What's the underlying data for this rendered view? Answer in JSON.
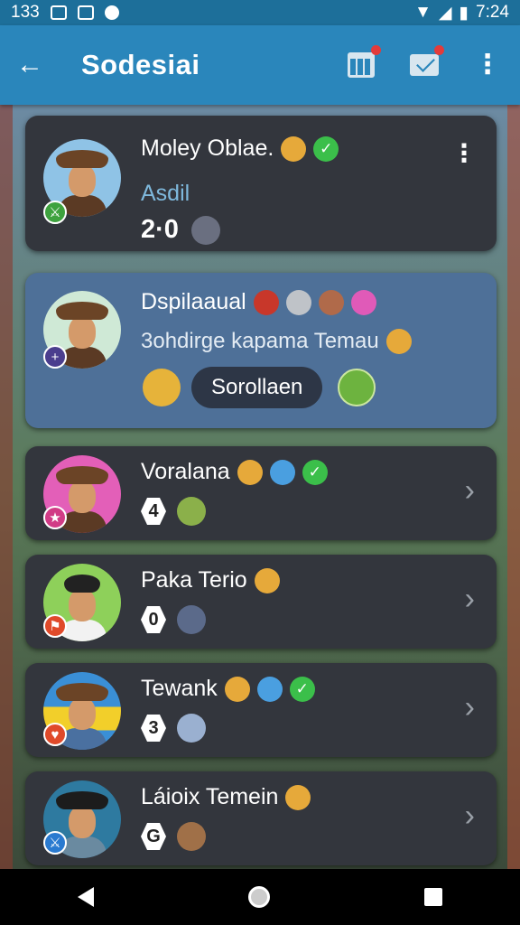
{
  "status_bar": {
    "left_text": "133",
    "time": "7:24"
  },
  "app_bar": {
    "title": "Sodesiai",
    "back_icon": "arrow-left-icon"
  },
  "members": [
    {
      "name": "Moley Oblae.",
      "subtitle": "Asdil",
      "score": "2·0"
    },
    {
      "name": "Dspilaaual",
      "description": "3ohdirge kapama Temau",
      "chip_label": "Sorollaen"
    },
    {
      "name": "Voralana",
      "rank": "4"
    },
    {
      "name": "Paka Terio",
      "rank": "0"
    },
    {
      "name": "Tewank",
      "rank": "3"
    },
    {
      "name": "Láioix Temein",
      "rank": "G"
    }
  ],
  "colors": {
    "app_bar": "#2a86bb",
    "status_bar": "#1d6f9a",
    "card": "#33363d",
    "card_selected": "#4e7098"
  }
}
